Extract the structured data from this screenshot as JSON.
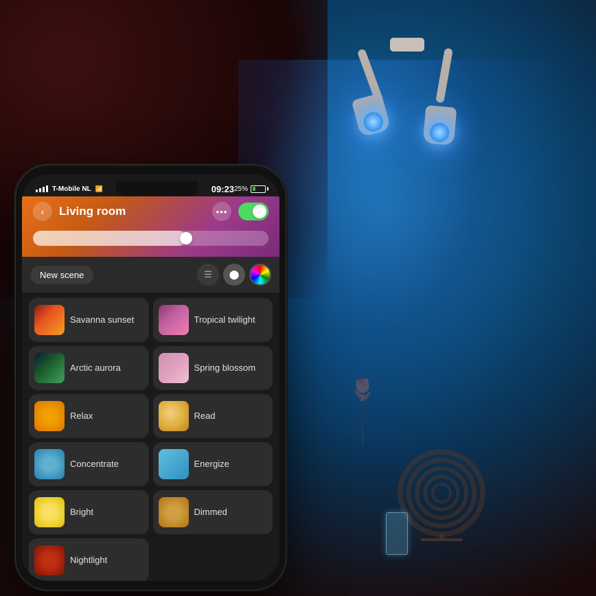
{
  "background": {
    "color": "#1a0a0a"
  },
  "status_bar": {
    "carrier": "T-Mobile NL",
    "time": "09:23",
    "battery_percent": "25%",
    "wifi": true
  },
  "header": {
    "title": "Living room",
    "back_label": "‹",
    "dots_label": "•••",
    "toggle_on": true
  },
  "controls": {
    "new_scene_label": "New scene",
    "list_icon": "☰",
    "color_wheel_icon": "●",
    "pin_icon": "◎"
  },
  "scenes": [
    {
      "id": "savanna-sunset",
      "name": "Savanna sunset",
      "thumb_class": "thumb-savanna"
    },
    {
      "id": "tropical-twilight",
      "name": "Tropical twilight",
      "thumb_class": "thumb-tropical"
    },
    {
      "id": "arctic-aurora",
      "name": "Arctic aurora",
      "thumb_class": "thumb-arctic"
    },
    {
      "id": "spring-blossom",
      "name": "Spring blossom",
      "thumb_class": "thumb-spring"
    },
    {
      "id": "relax",
      "name": "Relax",
      "thumb_class": "thumb-relax"
    },
    {
      "id": "read",
      "name": "Read",
      "thumb_class": "thumb-read"
    },
    {
      "id": "concentrate",
      "name": "Concentrate",
      "thumb_class": "thumb-concentrate"
    },
    {
      "id": "energize",
      "name": "Energize",
      "thumb_class": "thumb-energize"
    },
    {
      "id": "bright",
      "name": "Bright",
      "thumb_class": "thumb-bright"
    },
    {
      "id": "dimmed",
      "name": "Dimmed",
      "thumb_class": "thumb-dimmed"
    },
    {
      "id": "nightlight",
      "name": "Nightlight",
      "thumb_class": "thumb-nightlight"
    }
  ]
}
